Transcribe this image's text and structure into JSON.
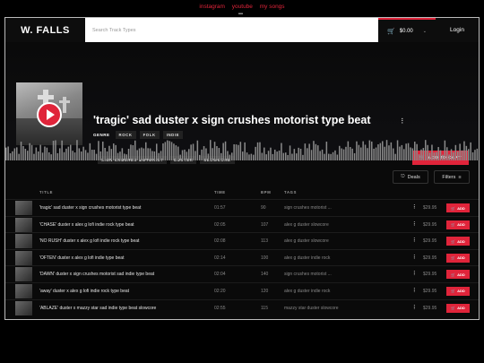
{
  "topnav": {
    "links": [
      "instagram",
      "youtube",
      "my songs"
    ]
  },
  "header": {
    "logo": "W. FALLS",
    "search_placeholder": "Search Track Types",
    "cart_total": "$0.00",
    "login": "Login"
  },
  "hero": {
    "title": "'tragic' sad duster x sign crushes motorist type beat",
    "genre_label": "GENRE",
    "genres": [
      "ROCK",
      "FOLK",
      "INDIE"
    ],
    "tags": [
      "SIGN CRUSHES MOTORIST",
      "DUSTER",
      "SLOWCORE"
    ],
    "add_to_cart": "ADD TO CART"
  },
  "toolbar": {
    "deals": "Deals",
    "filters": "Filters"
  },
  "table": {
    "headers": {
      "title": "TITLE",
      "time": "TIME",
      "bpm": "BPM",
      "tags": "TAGS"
    },
    "add_label": "ADD",
    "rows": [
      {
        "title": "'tragic' sad duster x sign crushes motorist type beat",
        "time": "01:57",
        "bpm": "90",
        "tags": "sign crushes motorist ...",
        "price": "$29.95"
      },
      {
        "title": "'CHASE' duster x alex g lofi indie rock type beat",
        "time": "02:05",
        "bpm": "107",
        "tags": "alex g  duster  slowcore",
        "price": "$29.95"
      },
      {
        "title": "'NO RUSH' duster x alex g lofi indie rock type beat",
        "time": "02:08",
        "bpm": "113",
        "tags": "alex g  duster  slowcore",
        "price": "$29.95"
      },
      {
        "title": "'OFTEN' duster x alex g lofi indie type beat",
        "time": "02:14",
        "bpm": "100",
        "tags": "alex g  duster  indie rock",
        "price": "$29.95"
      },
      {
        "title": "'DAWN' duster x sign crushes motorist sad indie type beat",
        "time": "02:04",
        "bpm": "140",
        "tags": "sign crushes motorist ...",
        "price": "$29.95"
      },
      {
        "title": "'away' duster x alex g lofi indie rock type beat",
        "time": "02:20",
        "bpm": "120",
        "tags": "alex g  duster  indie rock",
        "price": "$29.95"
      },
      {
        "title": "'ABLAZE' duster x mazzy star sad indie type beat slowcore",
        "time": "02:55",
        "bpm": "115",
        "tags": "mazzy star  duster  slowcore",
        "price": "$29.95"
      }
    ]
  },
  "colors": {
    "accent": "#e0243a",
    "background": "#0a0a0a"
  },
  "icons": {
    "play": "play-icon",
    "share": "share-icon",
    "cart": "cart-icon",
    "tag": "tag-icon",
    "filter": "filter-icon"
  }
}
